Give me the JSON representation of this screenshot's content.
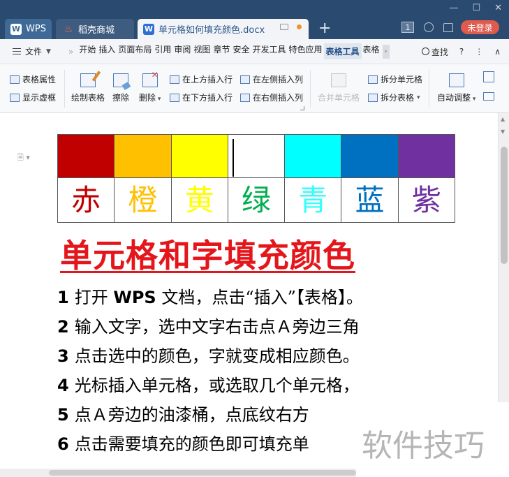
{
  "titlebar": {
    "tabs": [
      {
        "label": "WPS",
        "icon": "wps-logo-icon"
      },
      {
        "label": "稻壳商城",
        "icon": "docer-flame-icon"
      },
      {
        "label": "单元格如何填充颜色.docx",
        "icon": "word-doc-icon",
        "active": true
      }
    ],
    "badge_count": "1",
    "login_label": "未登录",
    "colors": {
      "bar": "#2b4a6f",
      "login": "#e05a4e"
    }
  },
  "menubar": {
    "file_label": "文件",
    "items": [
      "开始",
      "插入",
      "页面布局",
      "引用",
      "审阅",
      "视图",
      "章节",
      "安全",
      "开发工具",
      "特色应用",
      "表格工具",
      "表格"
    ],
    "active_item": "表格工具",
    "search_label": "查找",
    "help_glyph": "?",
    "more_glyph": "⋮",
    "collapse_glyph": "∧"
  },
  "ribbon": {
    "table_properties": "表格属性",
    "show_gridlines": "显示虚框",
    "draw_table": "绘制表格",
    "erase": "擦除",
    "delete": "删除",
    "insert_above": "在上方插入行",
    "insert_below": "在下方插入行",
    "insert_left": "在左侧插入列",
    "insert_right": "在右侧插入列",
    "merge_cells": "合并单元格",
    "split_cells": "拆分单元格",
    "split_table": "拆分表格",
    "auto_fit": "自动调整"
  },
  "document": {
    "swatches": [
      "#c00000",
      "#ffc000",
      "#ffff00",
      "#ffffff",
      "#00ffff",
      "#0070c0",
      "#7030a0"
    ],
    "color_words": [
      {
        "char": "赤",
        "color": "#c00000"
      },
      {
        "char": "橙",
        "color": "#ffc000"
      },
      {
        "char": "黄",
        "color": "#ffff00"
      },
      {
        "char": "绿",
        "color": "#00b050"
      },
      {
        "char": "青",
        "color": "#33ffff"
      },
      {
        "char": "蓝",
        "color": "#0070c0"
      },
      {
        "char": "紫",
        "color": "#7030a0"
      }
    ],
    "headline": "单元格和字填充颜色",
    "steps": [
      {
        "num": "1",
        "pre": "打开 ",
        "bold": "WPS",
        "post": " 文档，点击“插入”【表格】。"
      },
      {
        "num": "2",
        "pre": "输入文字，选中文字右击点Ａ旁边三角",
        "bold": "",
        "post": ""
      },
      {
        "num": "3",
        "pre": "点击选中的颜色，字就变成相应颜色。",
        "bold": "",
        "post": ""
      },
      {
        "num": "4",
        "pre": "光标插入单元格，或选取几个单元格，",
        "bold": "",
        "post": ""
      },
      {
        "num": "5",
        "pre": "点Ａ旁边的油漆桶，点底纹右方",
        "bold": "",
        "post": ""
      },
      {
        "num": "6",
        "pre": "点击需要填充的颜色即可填充单",
        "bold": "",
        "post": ""
      }
    ]
  },
  "watermark": "软件技巧"
}
